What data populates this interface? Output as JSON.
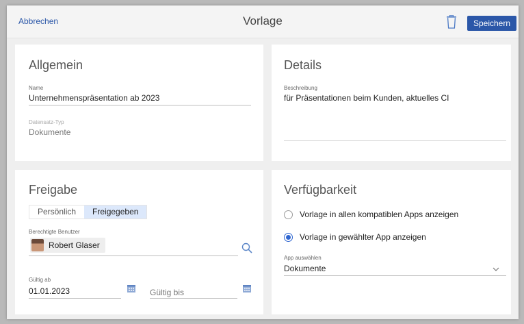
{
  "topbar": {
    "cancel_label": "Abbrechen",
    "title": "Vorlage",
    "save_label": "Speichern",
    "trash_icon": "trash-icon"
  },
  "general": {
    "title": "Allgemein",
    "name_label": "Name",
    "name_value": "Unternehmenspräsentation ab 2023",
    "type_label": "Datensatz-Typ",
    "type_value": "Dokumente"
  },
  "details": {
    "title": "Details",
    "description_label": "Beschreibung",
    "description_value": "für Präsentationen beim Kunden, aktuelles CI"
  },
  "sharing": {
    "title": "Freigabe",
    "tabs": [
      {
        "label": "Persönlich",
        "active": false
      },
      {
        "label": "Freigegeben",
        "active": true
      }
    ],
    "users_label": "Berechtigte Benutzer",
    "user_name": "Robert Glaser",
    "valid_from_label": "Gültig ab",
    "valid_from_value": "01.01.2023",
    "valid_to_placeholder": "Gültig bis"
  },
  "availability": {
    "title": "Verfügbarkeit",
    "options": [
      {
        "label": "Vorlage in allen kompatiblen Apps anzeigen",
        "selected": false
      },
      {
        "label": "Vorlage in gewählter App anzeigen",
        "selected": true
      }
    ],
    "app_label": "App auswählen",
    "app_value": "Dokumente"
  },
  "colors": {
    "accent": "#2b57a8",
    "radio_accent": "#2f66d0",
    "icon_blue": "#5b86c8",
    "background": "#efefef"
  }
}
